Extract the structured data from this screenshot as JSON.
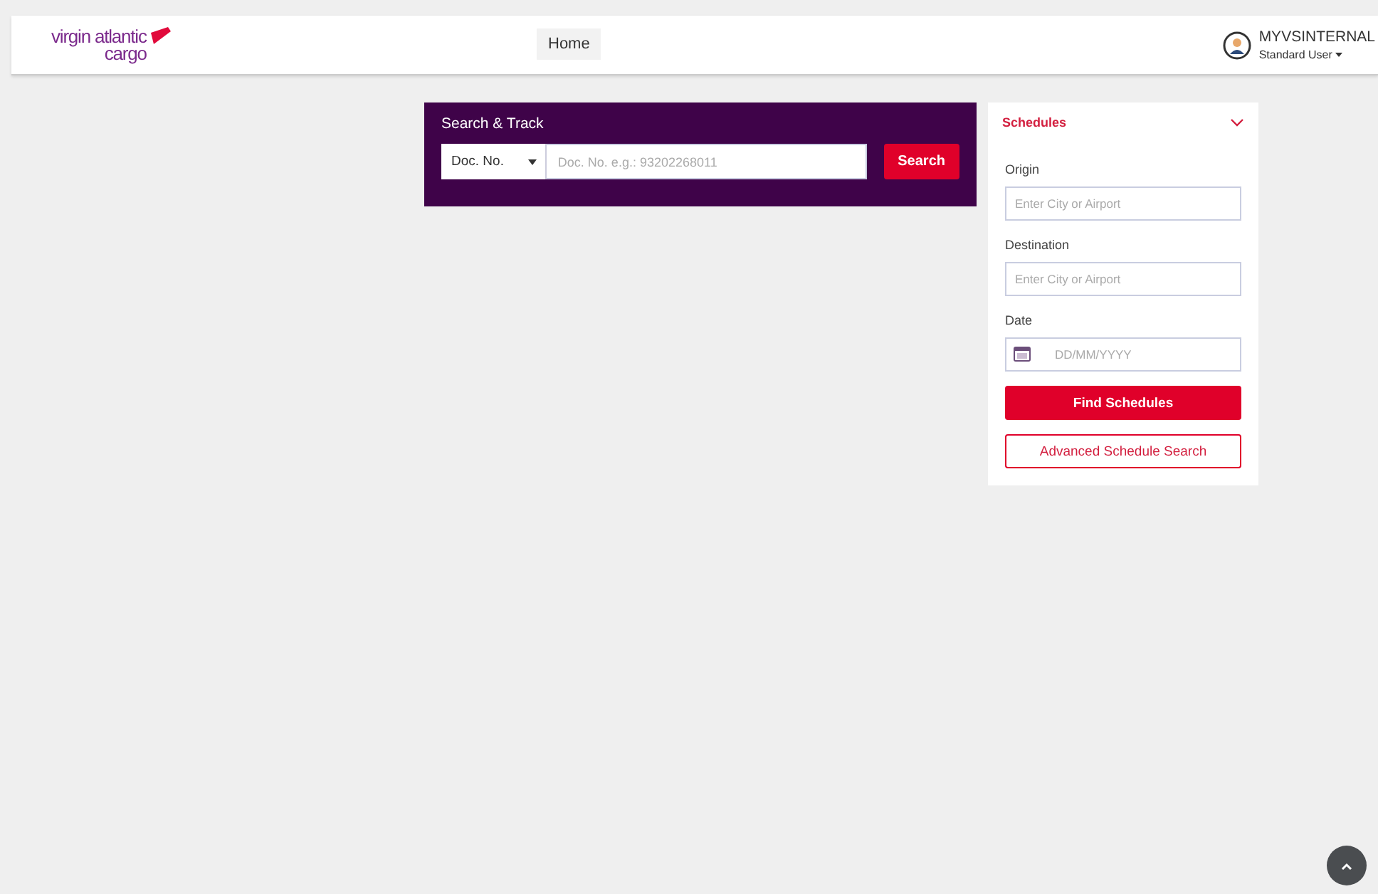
{
  "header": {
    "logo": {
      "line_1": "virgin atlantic",
      "line_2": "cargo"
    },
    "nav": [
      {
        "label": "Home",
        "selected": true
      }
    ],
    "user": {
      "name": "MYVSINTERNAL",
      "role": "Standard User"
    }
  },
  "search_track": {
    "title": "Search & Track",
    "type_select": {
      "value": "Doc. No."
    },
    "doc_field": {
      "placeholder": "Doc. No. e.g.: 93202268011"
    },
    "button": "Search"
  },
  "schedules": {
    "title": "Schedules",
    "expanded": true,
    "fields": [
      {
        "label": "Origin",
        "placeholder": "Enter City or Airport",
        "kind": "text"
      },
      {
        "label": "Destination",
        "placeholder": "Enter City or Airport",
        "kind": "text"
      },
      {
        "label": "Date",
        "placeholder": "DD/MM/YYYY",
        "kind": "date"
      }
    ],
    "primary_button": "Find Schedules",
    "secondary_button": "Advanced Schedule Search"
  }
}
